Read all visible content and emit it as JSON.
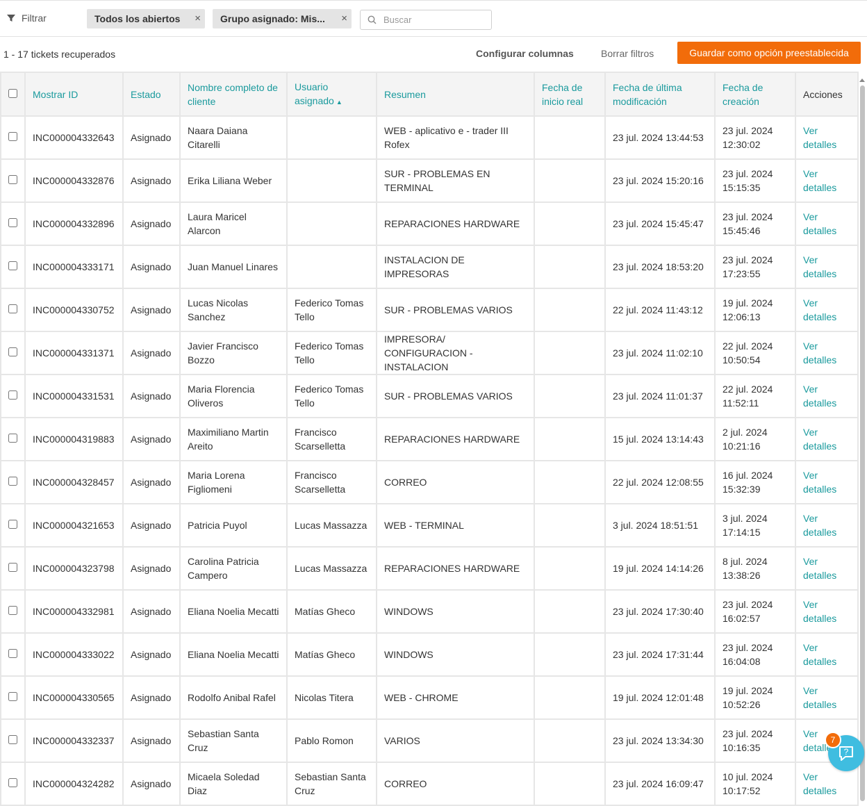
{
  "filterbar": {
    "filter_label": "Filtrar",
    "chips": [
      {
        "label": "Todos los abiertos",
        "remove": "×"
      },
      {
        "label": "Grupo asignado: Mis...",
        "remove": "×"
      }
    ],
    "search_placeholder": "Buscar"
  },
  "toolbar": {
    "count": "1 - 17 tickets recuperados",
    "configure_columns": "Configurar columnas",
    "clear_filters": "Borrar filtros",
    "save_preset": "Guardar como opción preestablecida"
  },
  "table": {
    "headers": {
      "id": "Mostrar ID",
      "status": "Estado",
      "customer": "Nombre completo de cliente",
      "assignee": "Usuario asignado",
      "summary": "Resumen",
      "start": "Fecha de inicio real",
      "modified": "Fecha de última modificación",
      "created": "Fecha de creación",
      "actions": "Acciones"
    },
    "sort_indicator": "▲",
    "rows": [
      {
        "id": "INC000004332643",
        "status": "Asignado",
        "customer": "Naara Daiana Citarelli",
        "assignee": "",
        "summary": "WEB - aplicativo e - trader III Rofex",
        "start": "",
        "modified": "23 jul. 2024 13:44:53",
        "created": "23 jul. 2024 12:30:02",
        "action": "Ver detalles"
      },
      {
        "id": "INC000004332876",
        "status": "Asignado",
        "customer": "Erika Liliana Weber",
        "assignee": "",
        "summary": "SUR - PROBLEMAS EN TERMINAL",
        "start": "",
        "modified": "23 jul. 2024 15:20:16",
        "created": "23 jul. 2024 15:15:35",
        "action": "Ver detalles"
      },
      {
        "id": "INC000004332896",
        "status": "Asignado",
        "customer": "Laura Maricel Alarcon",
        "assignee": "",
        "summary": "REPARACIONES HARDWARE",
        "start": "",
        "modified": "23 jul. 2024 15:45:47",
        "created": "23 jul. 2024 15:45:46",
        "action": "Ver detalles"
      },
      {
        "id": "INC000004333171",
        "status": "Asignado",
        "customer": "Juan Manuel Linares",
        "assignee": "",
        "summary": "INSTALACION DE IMPRESORAS",
        "start": "",
        "modified": "23 jul. 2024 18:53:20",
        "created": "23 jul. 2024 17:23:55",
        "action": "Ver detalles"
      },
      {
        "id": "INC000004330752",
        "status": "Asignado",
        "customer": "Lucas Nicolas Sanchez",
        "assignee": "Federico Tomas Tello",
        "summary": "SUR - PROBLEMAS VARIOS",
        "start": "",
        "modified": "22 jul. 2024 11:43:12",
        "created": "19 jul. 2024 12:06:13",
        "action": "Ver detalles"
      },
      {
        "id": "INC000004331371",
        "status": "Asignado",
        "customer": "Javier Francisco Bozzo",
        "assignee": "Federico Tomas Tello",
        "summary": "IMPRESORA/ CONFIGURACION - INSTALACION",
        "start": "",
        "modified": "23 jul. 2024 11:02:10",
        "created": "22 jul. 2024 10:50:54",
        "action": "Ver detalles"
      },
      {
        "id": "INC000004331531",
        "status": "Asignado",
        "customer": "Maria Florencia Oliveros",
        "assignee": "Federico Tomas Tello",
        "summary": "SUR - PROBLEMAS VARIOS",
        "start": "",
        "modified": "23 jul. 2024 11:01:37",
        "created": "22 jul. 2024 11:52:11",
        "action": "Ver detalles"
      },
      {
        "id": "INC000004319883",
        "status": "Asignado",
        "customer": "Maximiliano Martin Areito",
        "assignee": "Francisco Scarselletta",
        "summary": "REPARACIONES HARDWARE",
        "start": "",
        "modified": "15 jul. 2024 13:14:43",
        "created": "2 jul. 2024 10:21:16",
        "action": "Ver detalles"
      },
      {
        "id": "INC000004328457",
        "status": "Asignado",
        "customer": "Maria Lorena Figliomeni",
        "assignee": "Francisco Scarselletta",
        "summary": "CORREO",
        "start": "",
        "modified": "22 jul. 2024 12:08:55",
        "created": "16 jul. 2024 15:32:39",
        "action": "Ver detalles"
      },
      {
        "id": "INC000004321653",
        "status": "Asignado",
        "customer": "Patricia Puyol",
        "assignee": "Lucas Massazza",
        "summary": "WEB - TERMINAL",
        "start": "",
        "modified": "3 jul. 2024 18:51:51",
        "created": "3 jul. 2024 17:14:15",
        "action": "Ver detalles"
      },
      {
        "id": "INC000004323798",
        "status": "Asignado",
        "customer": "Carolina Patricia Campero",
        "assignee": "Lucas Massazza",
        "summary": "REPARACIONES HARDWARE",
        "start": "",
        "modified": "19 jul. 2024 14:14:26",
        "created": "8 jul. 2024 13:38:26",
        "action": "Ver detalles"
      },
      {
        "id": "INC000004332981",
        "status": "Asignado",
        "customer": "Eliana Noelia Mecatti",
        "assignee": "Matías Gheco",
        "summary": "WINDOWS",
        "start": "",
        "modified": "23 jul. 2024 17:30:40",
        "created": "23 jul. 2024 16:02:57",
        "action": "Ver detalles"
      },
      {
        "id": "INC000004333022",
        "status": "Asignado",
        "customer": "Eliana Noelia Mecatti",
        "assignee": "Matías Gheco",
        "summary": "WINDOWS",
        "start": "",
        "modified": "23 jul. 2024 17:31:44",
        "created": "23 jul. 2024 16:04:08",
        "action": "Ver detalles"
      },
      {
        "id": "INC000004330565",
        "status": "Asignado",
        "customer": "Rodolfo Anibal Rafel",
        "assignee": "Nicolas Titera",
        "summary": "WEB - CHROME",
        "start": "",
        "modified": "19 jul. 2024 12:01:48",
        "created": "19 jul. 2024 10:52:26",
        "action": "Ver detalles"
      },
      {
        "id": "INC000004332337",
        "status": "Asignado",
        "customer": "Sebastian Santa Cruz",
        "assignee": "Pablo Romon",
        "summary": "VARIOS",
        "start": "",
        "modified": "23 jul. 2024 13:34:30",
        "created": "23 jul. 2024 10:16:35",
        "action": "Ver detalles"
      },
      {
        "id": "INC000004324282",
        "status": "Asignado",
        "customer": "Micaela Soledad Diaz",
        "assignee": "Sebastian Santa Cruz",
        "summary": "CORREO",
        "start": "",
        "modified": "23 jul. 2024 16:09:47",
        "created": "10 jul. 2024 10:17:52",
        "action": "Ver detalles"
      }
    ]
  },
  "help": {
    "badge": "7",
    "icon": "help-chat-icon"
  },
  "colors": {
    "accent": "#1a9a9d",
    "primary_button": "#f26c0a",
    "help_bubble": "#3fbde0"
  }
}
